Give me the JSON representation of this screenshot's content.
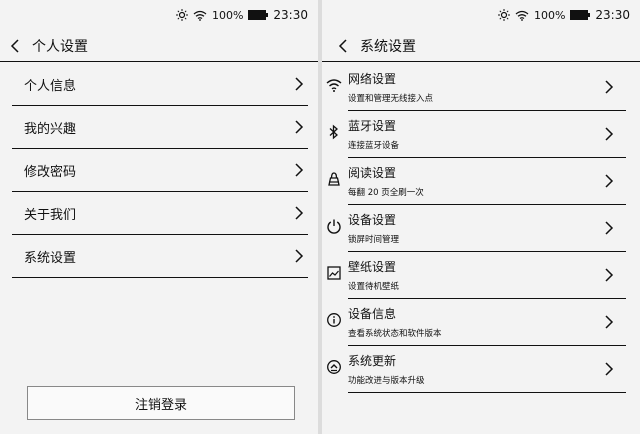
{
  "status": {
    "battery": "100%",
    "time": "23:30"
  },
  "left": {
    "title": "个人设置",
    "items": [
      {
        "label": "个人信息"
      },
      {
        "label": "我的兴趣"
      },
      {
        "label": "修改密码"
      },
      {
        "label": "关于我们"
      },
      {
        "label": "系统设置"
      }
    ],
    "logout_label": "注销登录"
  },
  "right": {
    "title": "系统设置",
    "items": [
      {
        "icon": "wifi-icon",
        "title": "网络设置",
        "subtitle": "设置和管理无线接入点"
      },
      {
        "icon": "bluetooth-icon",
        "title": "蓝牙设置",
        "subtitle": "连接蓝牙设备"
      },
      {
        "icon": "reading-icon",
        "title": "阅读设置",
        "subtitle": "每翻 20 页全刷一次"
      },
      {
        "icon": "power-icon",
        "title": "设备设置",
        "subtitle": "锁屏时间管理"
      },
      {
        "icon": "wallpaper-icon",
        "title": "壁纸设置",
        "subtitle": "设置待机壁纸"
      },
      {
        "icon": "info-icon",
        "title": "设备信息",
        "subtitle": "查看系统状态和软件版本"
      },
      {
        "icon": "update-icon",
        "title": "系统更新",
        "subtitle": "功能改进与版本升级"
      }
    ]
  }
}
